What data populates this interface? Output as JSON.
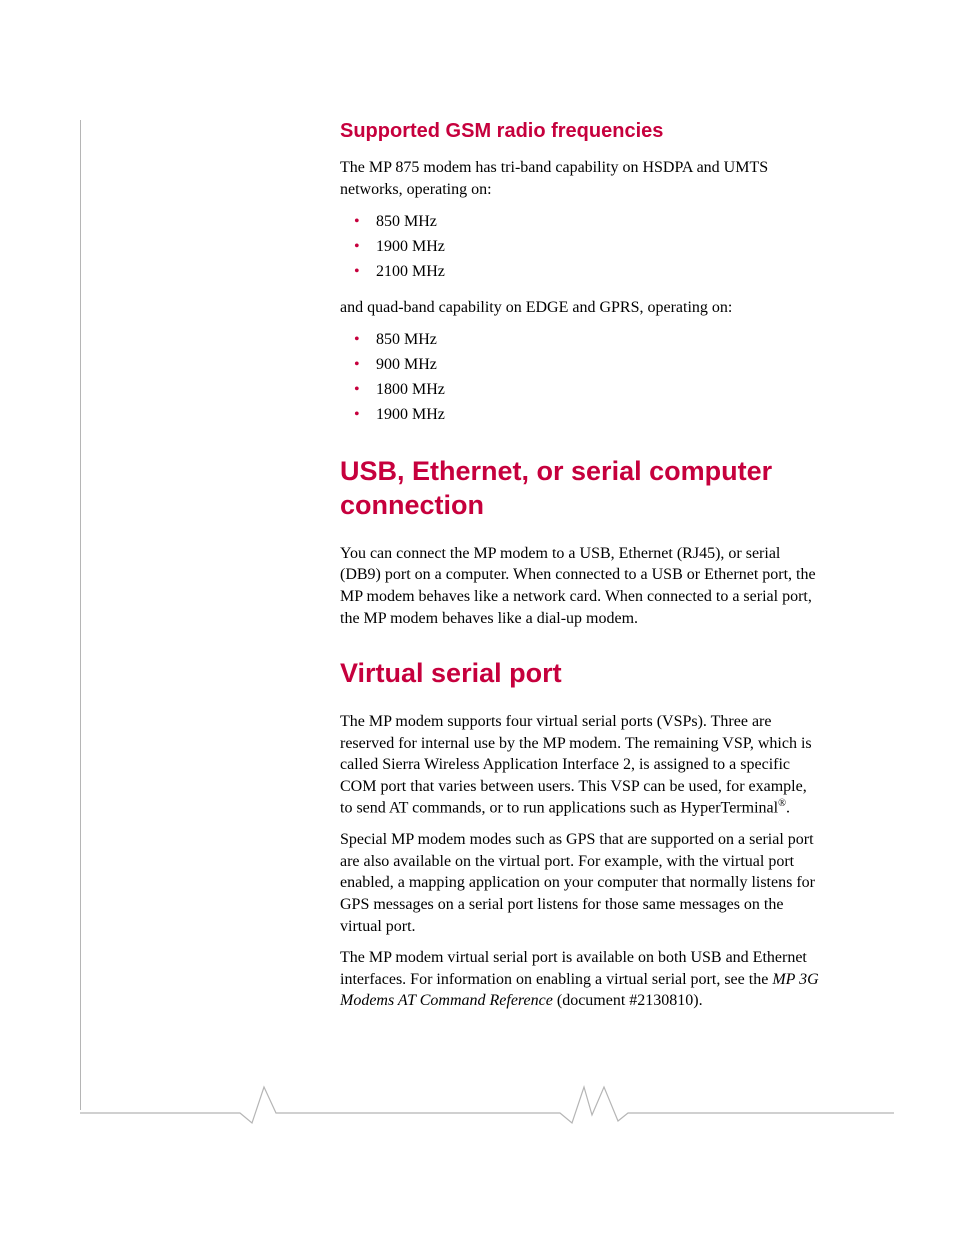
{
  "section_gsm": {
    "heading": "Supported GSM radio frequencies",
    "intro": "The MP 875 modem has tri-band capability on HSDPA and UMTS networks, operating on:",
    "list1": [
      "850 MHz",
      "1900 MHz",
      "2100 MHz"
    ],
    "mid": "and quad-band capability on EDGE and GPRS, operating on:",
    "list2": [
      "850 MHz",
      "900 MHz",
      "1800 MHz",
      "1900 MHz"
    ]
  },
  "section_usb": {
    "heading": "USB, Ethernet, or serial computer connection",
    "para": "You can connect the MP modem to a USB, Ethernet (RJ45), or serial (DB9) port on a computer. When connected to a USB or Ethernet port, the MP modem behaves like a network card. When connected to a serial port, the MP modem behaves like a dial-up modem."
  },
  "section_vsp": {
    "heading": "Virtual serial port",
    "para1_a": "The MP modem supports four virtual serial ports (VSPs). Three are reserved for internal use by the MP modem. The remaining VSP, which is called Sierra Wireless Application Interface 2, is assigned to a specific COM port that varies between users. This VSP can be used, for example, to send AT commands, or to run applications such as HyperTerminal",
    "para1_reg": "®",
    "para1_b": ".",
    "para2": "Special MP modem modes such as GPS that are supported on a serial port are also available on the virtual port. For example, with the virtual port enabled, a mapping application on your computer that normally listens for GPS messages on a serial port listens for those same messages on the virtual port.",
    "para3_a": "The MP modem virtual serial port is available on both USB and Ethernet interfaces. For information on enabling a virtual serial port, see the ",
    "para3_ref": "MP 3G Modems AT Command Reference",
    "para3_b": " (document #2130810)."
  }
}
